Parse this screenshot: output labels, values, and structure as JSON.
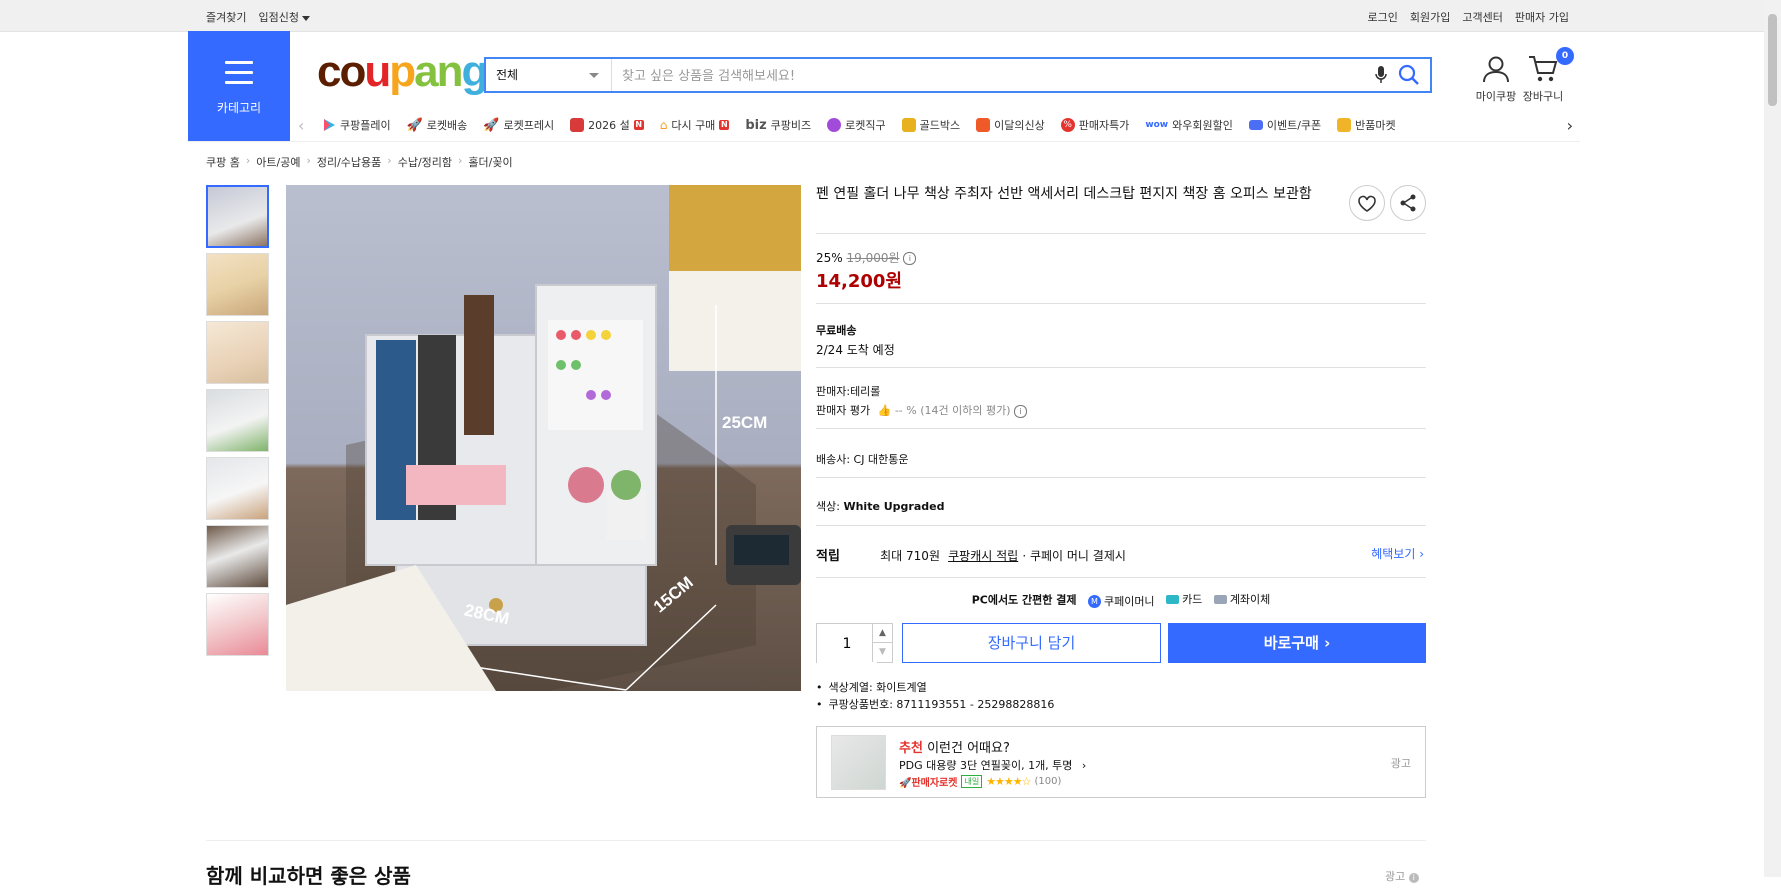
{
  "topbar": {
    "favorites": "즐겨찾기",
    "vendor_apply": "입점신청",
    "login": "로그인",
    "signup": "회원가입",
    "customer_center": "고객센터",
    "seller_signup": "판매자 가입"
  },
  "header": {
    "category_label": "카테고리",
    "logo": "coupang",
    "search_category": "전체",
    "search_placeholder": "찾고 싶은 상품을 검색해보세요!",
    "mycoupang": "마이쿠팡",
    "cart": "장바구니",
    "cart_count": "0"
  },
  "catnav": [
    "쿠팡플레이",
    "로켓배송",
    "로켓프레시",
    "2026 설",
    "다시 구매",
    "쿠팡비즈",
    "로켓직구",
    "골드박스",
    "이달의신상",
    "판매자특가",
    "와우회원할인",
    "이벤트/쿠폰",
    "반품마켓"
  ],
  "breadcrumb": [
    "쿠팡 홈",
    "아트/공예",
    "정리/수납용품",
    "수납/정리함",
    "홀더/꽂이"
  ],
  "product": {
    "title": "펜 연필 홀더 나무 책상 주최자 선반 액세서리 데스크탑 편지지 책장 홈 오피스 보관함",
    "discount": "25%",
    "original_price": "19,000원",
    "price": "14,200원",
    "shipping_label": "무료배송",
    "arrival": "2/24 도착 예정",
    "seller": "판매자:테리롤",
    "seller_rating_label": "판매자 평가",
    "seller_rating_value": "-- % (14건 이하의 평가)",
    "carrier": "배송사:  CJ 대한통운",
    "color_label": "색상:",
    "color_value": "White Upgraded",
    "reward_label": "적립",
    "reward_text": "최대 710원",
    "reward_link": "쿠팡캐시 적립",
    "reward_suffix": "· 쿠페이 머니 결제시",
    "benefit_link": "혜택보기",
    "pay_title": "PC에서도 간편한 결제",
    "pay_methods": [
      "쿠페이머니",
      "카드",
      "계좌이체"
    ],
    "quantity": "1",
    "add_to_cart": "장바구니 담기",
    "buy_now": "바로구매",
    "color_family": "색상계열: 화이트계열",
    "product_no": "쿠팡상품번호: 8711193551 - 25298828816",
    "image_labels": [
      "25CM",
      "28CM",
      "15CM"
    ]
  },
  "recommend": {
    "title_red": "추천",
    "title": "이런건 어때요?",
    "name": "PDG 대용량 3단 연필꽂이, 1개, 투명",
    "badge": "판매자로켓",
    "badge2": "내일",
    "reviews": "(100)",
    "rating": 4.5,
    "ad": "광고"
  },
  "section": {
    "title": "함께 비교하면 좋은 상품",
    "ad": "광고"
  },
  "colors": {
    "brand_blue": "#346aff",
    "price_red": "#ae0000"
  }
}
